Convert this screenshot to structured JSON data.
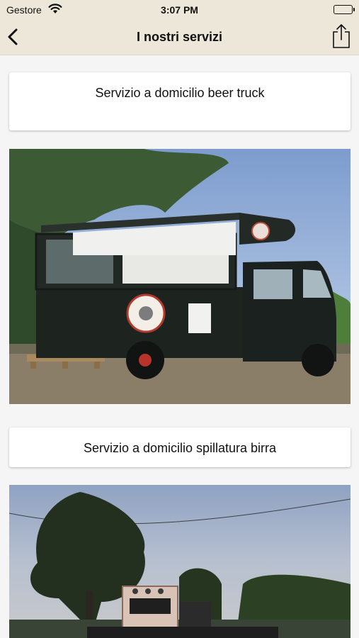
{
  "status_bar": {
    "carrier": "Gestore",
    "time": "3:07 PM"
  },
  "nav": {
    "title": "I nostri servizi",
    "back_icon": "chevron-left-icon",
    "share_icon": "share-icon"
  },
  "services": [
    {
      "label": "Servizio a domicilio beer truck"
    },
    {
      "label": "Servizio a domicilio spillatura birra"
    }
  ],
  "colors": {
    "bar_background": "#ece7d8",
    "content_background": "#f5f5f5"
  }
}
